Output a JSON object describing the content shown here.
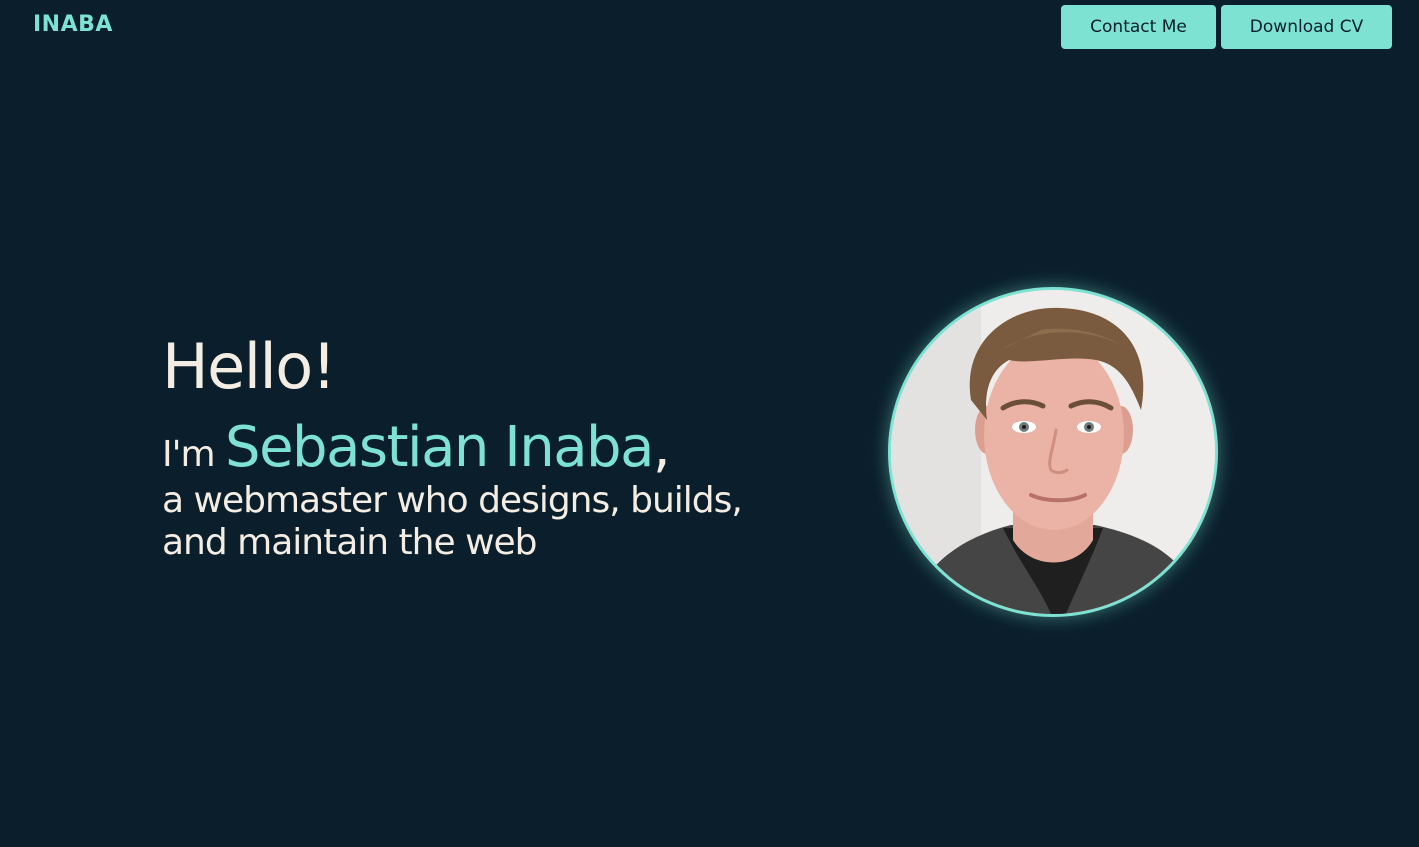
{
  "header": {
    "logo": "INABA",
    "contact_label": "Contact Me",
    "download_label": "Download CV"
  },
  "hero": {
    "greeting": "Hello!",
    "im": "I'm ",
    "name": "Sebastian Inaba",
    "comma": ",",
    "tagline": "a webmaster who designs, builds, and maintain the web"
  },
  "colors": {
    "background": "#0a1f2b",
    "accent": "#7de2d1",
    "text": "#f4ede4"
  }
}
